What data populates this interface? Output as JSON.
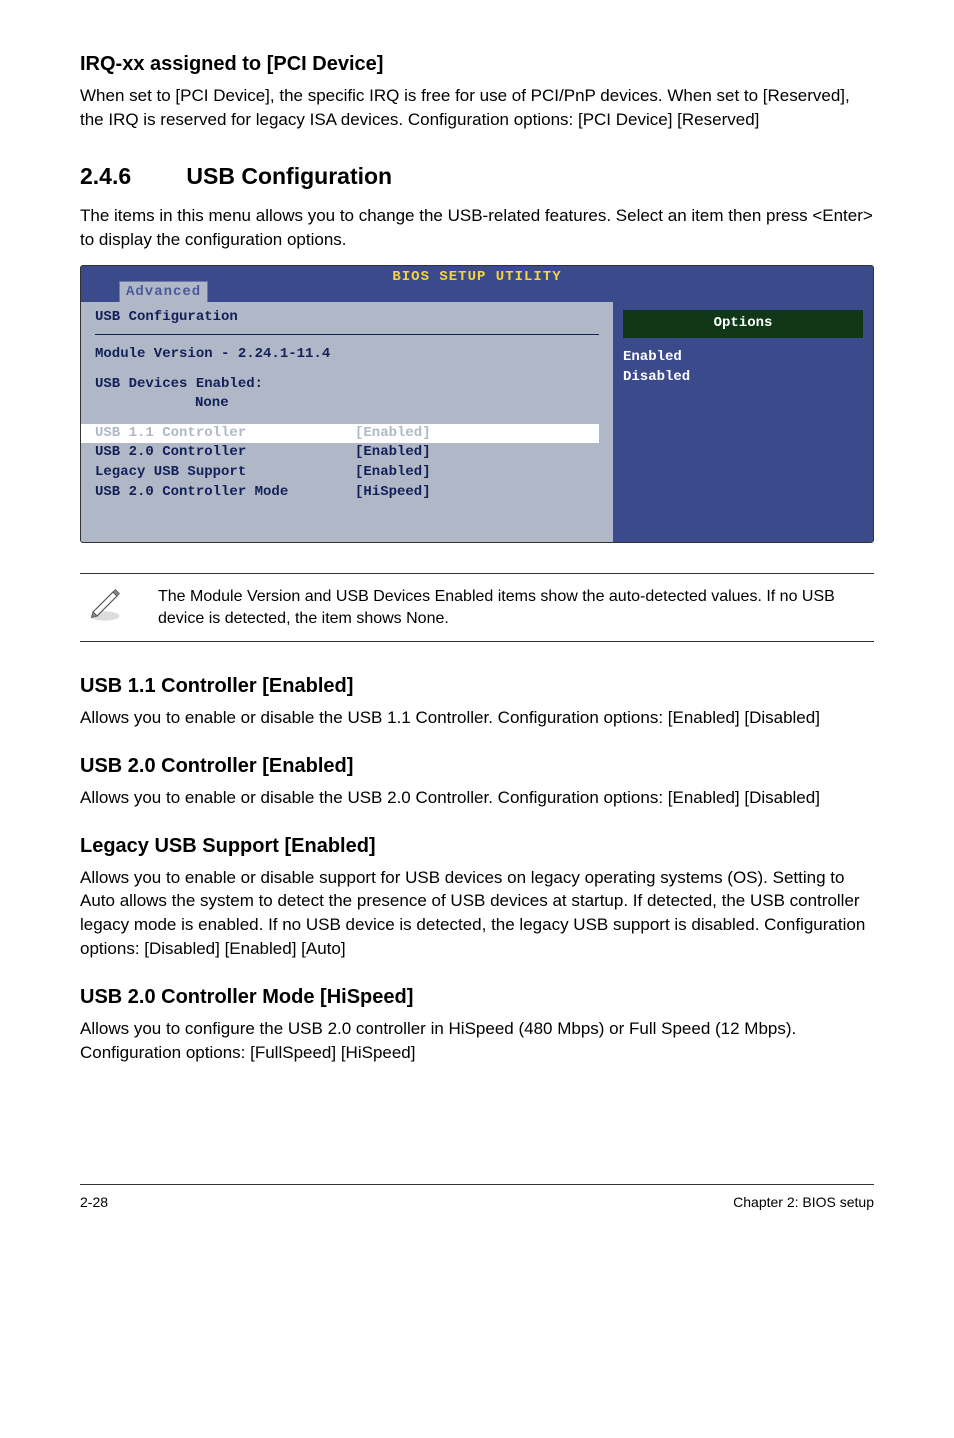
{
  "irq": {
    "heading": "IRQ-xx assigned to [PCI Device]",
    "p1": "When set to [PCI Device], the specific IRQ is free for use of PCI/PnP devices. When set to [Reserved], the IRQ is reserved for legacy ISA devices. Configuration options: [PCI Device] [Reserved]"
  },
  "section": {
    "num": "2.4.6",
    "title": "USB Configuration",
    "intro": "The items in this menu allows you to change the USB-related features. Select an item then press <Enter> to display the configuration options."
  },
  "bios": {
    "headerTitle": "BIOS SETUP UTILITY",
    "tab": "Advanced",
    "left": {
      "title": "USB Configuration",
      "module": "Module Version - 2.24.1-11.4",
      "devicesLabel": "USB Devices Enabled:",
      "devicesValue": "None",
      "rows": [
        {
          "label": "USB 1.1 Controller",
          "value": "[Enabled]"
        },
        {
          "label": "USB 2.0 Controller",
          "value": "[Enabled]"
        },
        {
          "label": "Legacy USB Support",
          "value": "[Enabled]"
        },
        {
          "label": "USB 2.0 Controller Mode",
          "value": "[HiSpeed]"
        }
      ]
    },
    "right": {
      "optionsTitle": "Options",
      "opt1": "Enabled",
      "opt2": "Disabled"
    }
  },
  "note": "The Module Version and USB Devices Enabled items show the auto-detected values. If no USB device is detected, the item shows None.",
  "usb11": {
    "heading": "USB 1.1 Controller [Enabled]",
    "body": "Allows you to enable or disable the USB 1.1 Controller. Configuration options: [Enabled] [Disabled]"
  },
  "usb20": {
    "heading": "USB 2.0 Controller [Enabled]",
    "body": "Allows you to enable or disable the USB 2.0 Controller. Configuration options: [Enabled] [Disabled]"
  },
  "legacy": {
    "heading": "Legacy USB Support [Enabled]",
    "body": "Allows you to enable or disable support for USB devices on legacy operating systems (OS). Setting to Auto allows the system to detect the presence of USB devices at startup. If detected, the USB controller legacy mode is enabled. If no USB device is detected, the legacy USB support is disabled. Configuration options: [Disabled] [Enabled] [Auto]"
  },
  "usb20mode": {
    "heading": "USB 2.0 Controller Mode [HiSpeed]",
    "body": "Allows you to configure the USB 2.0 controller in HiSpeed (480 Mbps) or Full Speed (12 Mbps). Configuration options: [FullSpeed] [HiSpeed]"
  },
  "footer": {
    "left": "2-28",
    "right": "Chapter 2: BIOS setup"
  }
}
